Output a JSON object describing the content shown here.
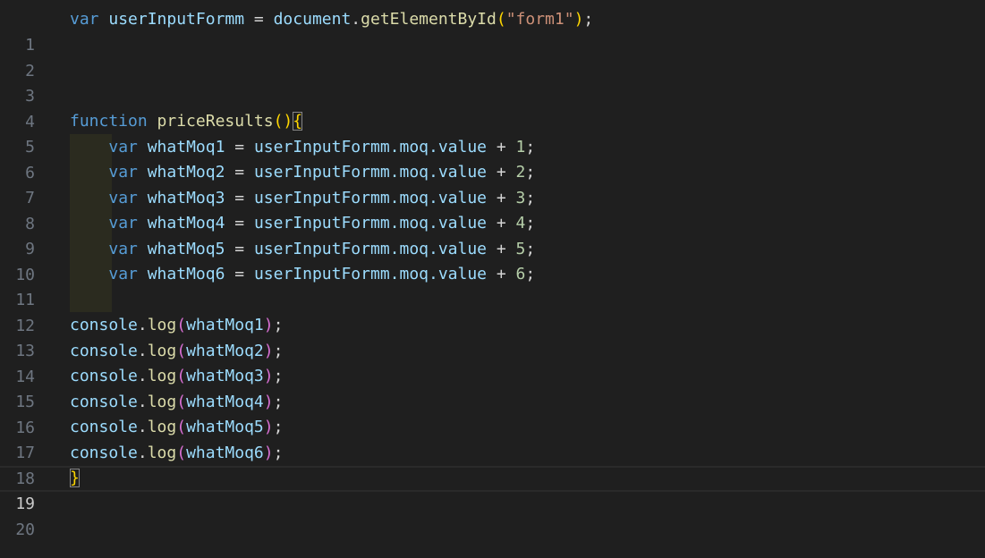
{
  "editor": {
    "lines": [
      {
        "number": "1",
        "kw": "var",
        "name": "userInputFormm",
        "eq": " = ",
        "obj": "document",
        "dot": ".",
        "method": "getElementById",
        "open": "(",
        "str": "\"form1\"",
        "close": ")",
        "semi": ";"
      },
      {
        "number": "2"
      },
      {
        "number": "3"
      },
      {
        "number": "4"
      },
      {
        "number": "5",
        "kw": "function",
        "fname": "priceResults",
        "parens": "()",
        "brace": "{"
      },
      {
        "number": "6",
        "kw": "var",
        "name": "whatMoq1",
        "eq": " = ",
        "expr": "userInputFormm.moq.value",
        "plus": " + ",
        "num": "1",
        "semi": ";"
      },
      {
        "number": "7",
        "kw": "var",
        "name": "whatMoq2",
        "eq": " = ",
        "expr": "userInputFormm.moq.value",
        "plus": " + ",
        "num": "2",
        "semi": ";"
      },
      {
        "number": "8",
        "kw": "var",
        "name": "whatMoq3",
        "eq": " = ",
        "expr": "userInputFormm.moq.value",
        "plus": " + ",
        "num": "3",
        "semi": ";"
      },
      {
        "number": "9",
        "kw": "var",
        "name": "whatMoq4",
        "eq": " = ",
        "expr": "userInputFormm.moq.value",
        "plus": " + ",
        "num": "4",
        "semi": ";"
      },
      {
        "number": "10",
        "kw": "var",
        "name": "whatMoq5",
        "eq": " = ",
        "expr": "userInputFormm.moq.value",
        "plus": " + ",
        "num": "5",
        "semi": ";"
      },
      {
        "number": "11",
        "kw": "var",
        "name": "whatMoq6",
        "eq": " = ",
        "expr": "userInputFormm.moq.value",
        "plus": " + ",
        "num": "6",
        "semi": ";"
      },
      {
        "number": "12"
      },
      {
        "number": "13",
        "obj": "console",
        "dot": ".",
        "method": "log",
        "open": "(",
        "arg": "whatMoq1",
        "close": ")",
        "semi": ";"
      },
      {
        "number": "14",
        "obj": "console",
        "dot": ".",
        "method": "log",
        "open": "(",
        "arg": "whatMoq2",
        "close": ")",
        "semi": ";"
      },
      {
        "number": "15",
        "obj": "console",
        "dot": ".",
        "method": "log",
        "open": "(",
        "arg": "whatMoq3",
        "close": ")",
        "semi": ";"
      },
      {
        "number": "16",
        "obj": "console",
        "dot": ".",
        "method": "log",
        "open": "(",
        "arg": "whatMoq4",
        "close": ")",
        "semi": ";"
      },
      {
        "number": "17",
        "obj": "console",
        "dot": ".",
        "method": "log",
        "open": "(",
        "arg": "whatMoq5",
        "close": ")",
        "semi": ";"
      },
      {
        "number": "18",
        "obj": "console",
        "dot": ".",
        "method": "log",
        "open": "(",
        "arg": "whatMoq6",
        "close": ")",
        "semi": ";"
      },
      {
        "number": "19",
        "brace": "}"
      },
      {
        "number": "20"
      }
    ],
    "active_line": "19"
  },
  "colors": {
    "background": "#1f1f1f",
    "keyword": "#569cd6",
    "variable": "#9cdcfe",
    "function": "#dcdcaa",
    "string": "#ce9178",
    "number": "#b5cea8",
    "bracket_level1": "#ffd700",
    "bracket_level2": "#da70d6"
  }
}
